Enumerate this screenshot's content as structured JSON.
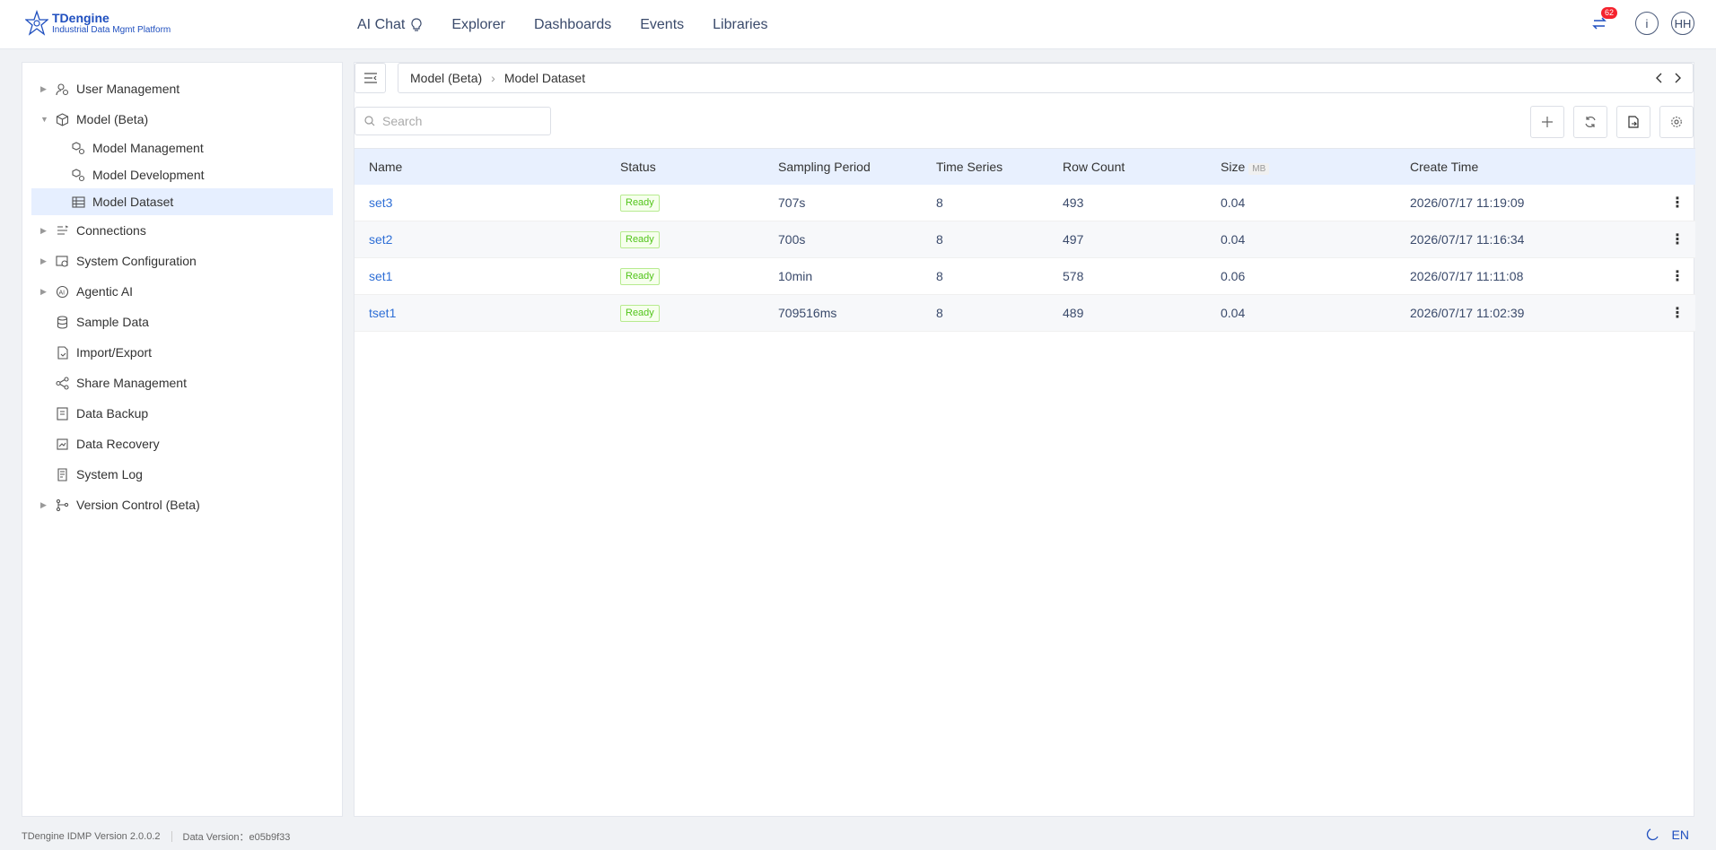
{
  "app": {
    "logo_title": "TDengine",
    "logo_subtitle": "Industrial Data Mgmt Platform"
  },
  "nav": {
    "items": [
      {
        "label": "AI Chat"
      },
      {
        "label": "Explorer"
      },
      {
        "label": "Dashboards"
      },
      {
        "label": "Events"
      },
      {
        "label": "Libraries"
      }
    ]
  },
  "header": {
    "notification_count": "62",
    "info_label": "i",
    "avatar_initials": "HH"
  },
  "sidebar": {
    "items": [
      {
        "label": "User Management",
        "icon": "user-gear-icon"
      },
      {
        "label": "Model (Beta)",
        "icon": "cube-icon"
      },
      {
        "label": "Model Management",
        "icon": "model-gear-icon"
      },
      {
        "label": "Model Development",
        "icon": "model-gear-icon"
      },
      {
        "label": "Model Dataset",
        "icon": "table-icon"
      },
      {
        "label": "Connections",
        "icon": "connections-icon"
      },
      {
        "label": "System Configuration",
        "icon": "system-config-icon"
      },
      {
        "label": "Agentic AI",
        "icon": "ai-icon"
      },
      {
        "label": "Sample Data",
        "icon": "database-icon"
      },
      {
        "label": "Import/Export",
        "icon": "import-export-icon"
      },
      {
        "label": "Share Management",
        "icon": "share-icon"
      },
      {
        "label": "Data Backup",
        "icon": "backup-icon"
      },
      {
        "label": "Data Recovery",
        "icon": "recovery-icon"
      },
      {
        "label": "System Log",
        "icon": "log-icon"
      },
      {
        "label": "Version Control (Beta)",
        "icon": "branch-icon"
      }
    ]
  },
  "breadcrumb": {
    "parent": "Model (Beta)",
    "current": "Model Dataset"
  },
  "search": {
    "placeholder": "Search"
  },
  "table": {
    "headers": {
      "name": "Name",
      "status": "Status",
      "sampling_period": "Sampling Period",
      "time_series": "Time Series",
      "row_count": "Row Count",
      "size": "Size",
      "size_unit": "MB",
      "create_time": "Create Time"
    },
    "rows": [
      {
        "name": "set3",
        "status": "Ready",
        "sampling_period": "707s",
        "time_series": "8",
        "row_count": "493",
        "size": "0.04",
        "create_time": "2026/07/17 11:19:09"
      },
      {
        "name": "set2",
        "status": "Ready",
        "sampling_period": "700s",
        "time_series": "8",
        "row_count": "497",
        "size": "0.04",
        "create_time": "2026/07/17 11:16:34"
      },
      {
        "name": "set1",
        "status": "Ready",
        "sampling_period": "10min",
        "time_series": "8",
        "row_count": "578",
        "size": "0.06",
        "create_time": "2026/07/17 11:11:08"
      },
      {
        "name": "tset1",
        "status": "Ready",
        "sampling_period": "709516ms",
        "time_series": "8",
        "row_count": "489",
        "size": "0.04",
        "create_time": "2026/07/17 11:02:39"
      }
    ]
  },
  "footer": {
    "app_version": "TDengine IDMP Version 2.0.0.2",
    "data_version": "Data Version：e05b9f33",
    "language": "EN"
  },
  "colors": {
    "brand": "#1f4fbf",
    "link": "#2f6fd6",
    "selected_bg": "#e6efff",
    "table_header_bg": "#e8f0fe",
    "status_ready": "#52c41a",
    "badge": "#f5222d"
  }
}
